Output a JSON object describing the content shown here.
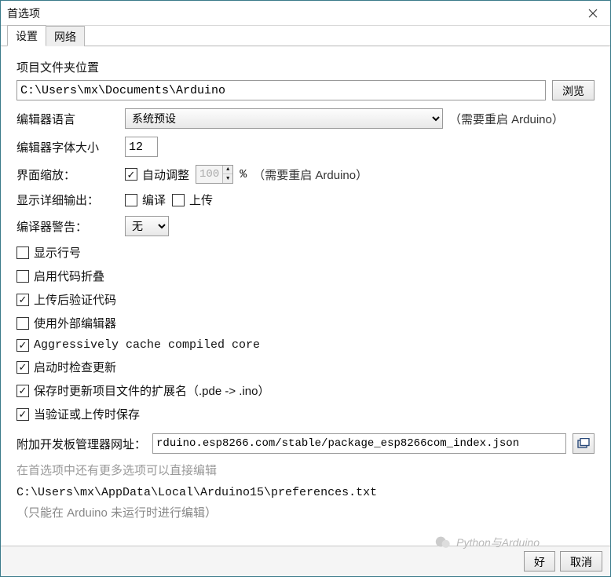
{
  "window": {
    "title": "首选项"
  },
  "tabs": {
    "settings": "设置",
    "network": "网络"
  },
  "sketchbook": {
    "label": "项目文件夹位置",
    "path": "C:\\Users\\mx\\Documents\\Arduino",
    "browse": "浏览"
  },
  "language": {
    "label": "编辑器语言",
    "value": "系统预设",
    "restart": "（需要重启 Arduino）"
  },
  "fontsize": {
    "label": "编辑器字体大小",
    "value": "12"
  },
  "uiscale": {
    "label": "界面缩放：",
    "auto_label": "自动调整",
    "auto_checked": true,
    "value": "100",
    "pct": "%",
    "restart": "（需要重启 Arduino）"
  },
  "verbose": {
    "label": "显示详细输出：",
    "compile_label": "编译",
    "compile_checked": false,
    "upload_label": "上传",
    "upload_checked": false
  },
  "warnings": {
    "label": "编译器警告：",
    "value": "无"
  },
  "checks": [
    {
      "label": "显示行号",
      "checked": false
    },
    {
      "label": "启用代码折叠",
      "checked": false
    },
    {
      "label": "上传后验证代码",
      "checked": true
    },
    {
      "label": "使用外部编辑器",
      "checked": false
    },
    {
      "label": "Aggressively cache compiled core",
      "checked": true,
      "mono": true
    },
    {
      "label": "启动时检查更新",
      "checked": true
    },
    {
      "label": "保存时更新项目文件的扩展名（.pde -> .ino）",
      "checked": true
    },
    {
      "label": "当验证或上传时保存",
      "checked": true
    }
  ],
  "boards_url": {
    "label": "附加开发板管理器网址：",
    "value": "rduino.esp8266.com/stable/package_esp8266com_index.json"
  },
  "more_prefs_hint": "在首选项中还有更多选项可以直接编辑",
  "prefs_path": "C:\\Users\\mx\\AppData\\Local\\Arduino15\\preferences.txt",
  "prefs_note": "（只能在 Arduino 未运行时进行编辑）",
  "buttons": {
    "ok": "好",
    "cancel": "取消"
  },
  "watermark": "Python与Arduino"
}
